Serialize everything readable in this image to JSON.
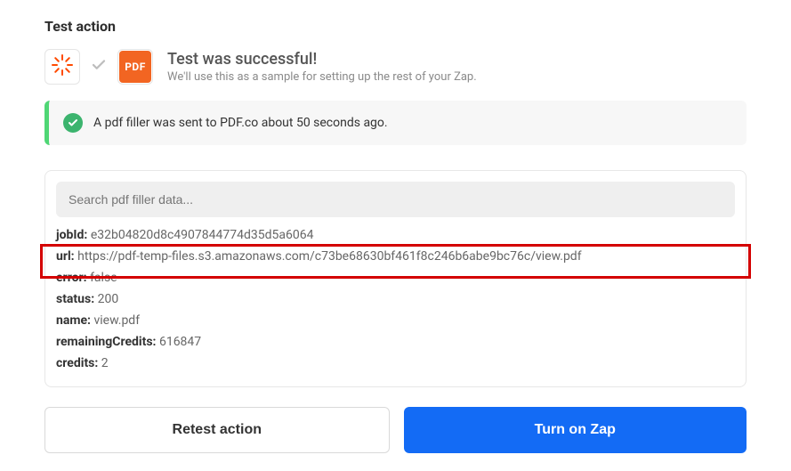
{
  "section": {
    "title": "Test action"
  },
  "header": {
    "pdf_badge": "PDF",
    "title": "Test was successful!",
    "subtitle": "We'll use this as a sample for setting up the rest of your Zap."
  },
  "status": {
    "text": "A pdf filler was sent to PDF.co about 50 seconds ago."
  },
  "search": {
    "placeholder": "Search pdf filler data..."
  },
  "results": {
    "jobId": {
      "label": "jobId:",
      "value": "e32b04820d8c4907844774d35d5a6064"
    },
    "url": {
      "label": "url:",
      "value": "https://pdf-temp-files.s3.amazonaws.com/c73be68630bf461f8c246b6abe9bc76c/view.pdf"
    },
    "error": {
      "label": "error:",
      "value": "false"
    },
    "status": {
      "label": "status:",
      "value": "200"
    },
    "name": {
      "label": "name:",
      "value": "view.pdf"
    },
    "remainingCredits": {
      "label": "remainingCredits:",
      "value": "616847"
    },
    "credits": {
      "label": "credits:",
      "value": "2"
    }
  },
  "buttons": {
    "retest": "Retest action",
    "turnon": "Turn on Zap"
  },
  "colors": {
    "accent_orange": "#f26522",
    "accent_green": "#3cb46e",
    "accent_blue": "#136bf5",
    "highlight_red": "#d40000"
  }
}
